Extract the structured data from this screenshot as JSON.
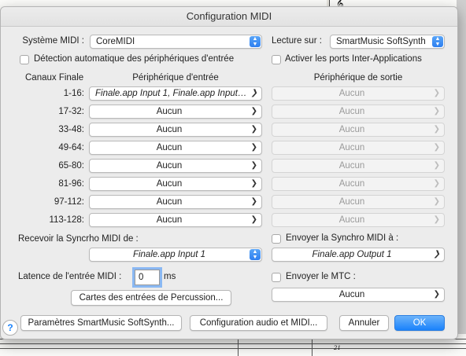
{
  "dialog": {
    "title": "Configuration MIDI"
  },
  "midi_system": {
    "label": "Système MIDI :",
    "value": "CoreMIDI"
  },
  "playback": {
    "label": "Lecture sur :",
    "value": "SmartMusic SoftSynth"
  },
  "auto_detect": {
    "label": "Détection automatique des périphériques d'entrée",
    "checked": false
  },
  "inter_app": {
    "label": "Activer les ports Inter-Applications",
    "checked": false
  },
  "columns": {
    "channels": "Canaux Finale",
    "input": "Périphérique d'entrée",
    "output": "Périphérique de sortie"
  },
  "rows": [
    {
      "channel": "1-16:",
      "input": "Finale.app Input 1, Finale.app Input 2,...",
      "output": "Aucun"
    },
    {
      "channel": "17-32:",
      "input": "Aucun",
      "output": "Aucun"
    },
    {
      "channel": "33-48:",
      "input": "Aucun",
      "output": "Aucun"
    },
    {
      "channel": "49-64:",
      "input": "Aucun",
      "output": "Aucun"
    },
    {
      "channel": "65-80:",
      "input": "Aucun",
      "output": "Aucun"
    },
    {
      "channel": "81-96:",
      "input": "Aucun",
      "output": "Aucun"
    },
    {
      "channel": "97-112:",
      "input": "Aucun",
      "output": "Aucun"
    },
    {
      "channel": "113-128:",
      "input": "Aucun",
      "output": "Aucun"
    }
  ],
  "sync_receive": {
    "label": "Recevoir la Syncrho MIDI de :",
    "value": "Finale.app Input 1"
  },
  "sync_send": {
    "label": "Envoyer la Synchro MIDI à :",
    "value": "Finale.app Output 1",
    "checked": false
  },
  "latency": {
    "label": "Latence de l'entrée MIDI :",
    "value": "0",
    "unit": "ms"
  },
  "mtc": {
    "label": "Envoyer le MTC :",
    "value": "Aucun",
    "checked": false
  },
  "buttons": {
    "percussion": "Cartes des entrées de Percussion...",
    "smartmusic": "Paramètres SmartMusic SoftSynth...",
    "audio_midi": "Configuration audio et MIDI...",
    "cancel": "Annuler",
    "ok": "OK",
    "help": "?"
  },
  "background": {
    "measure_number": "21"
  },
  "colors": {
    "accent": "#1a82fb",
    "dialog_bg": "#ececec"
  }
}
